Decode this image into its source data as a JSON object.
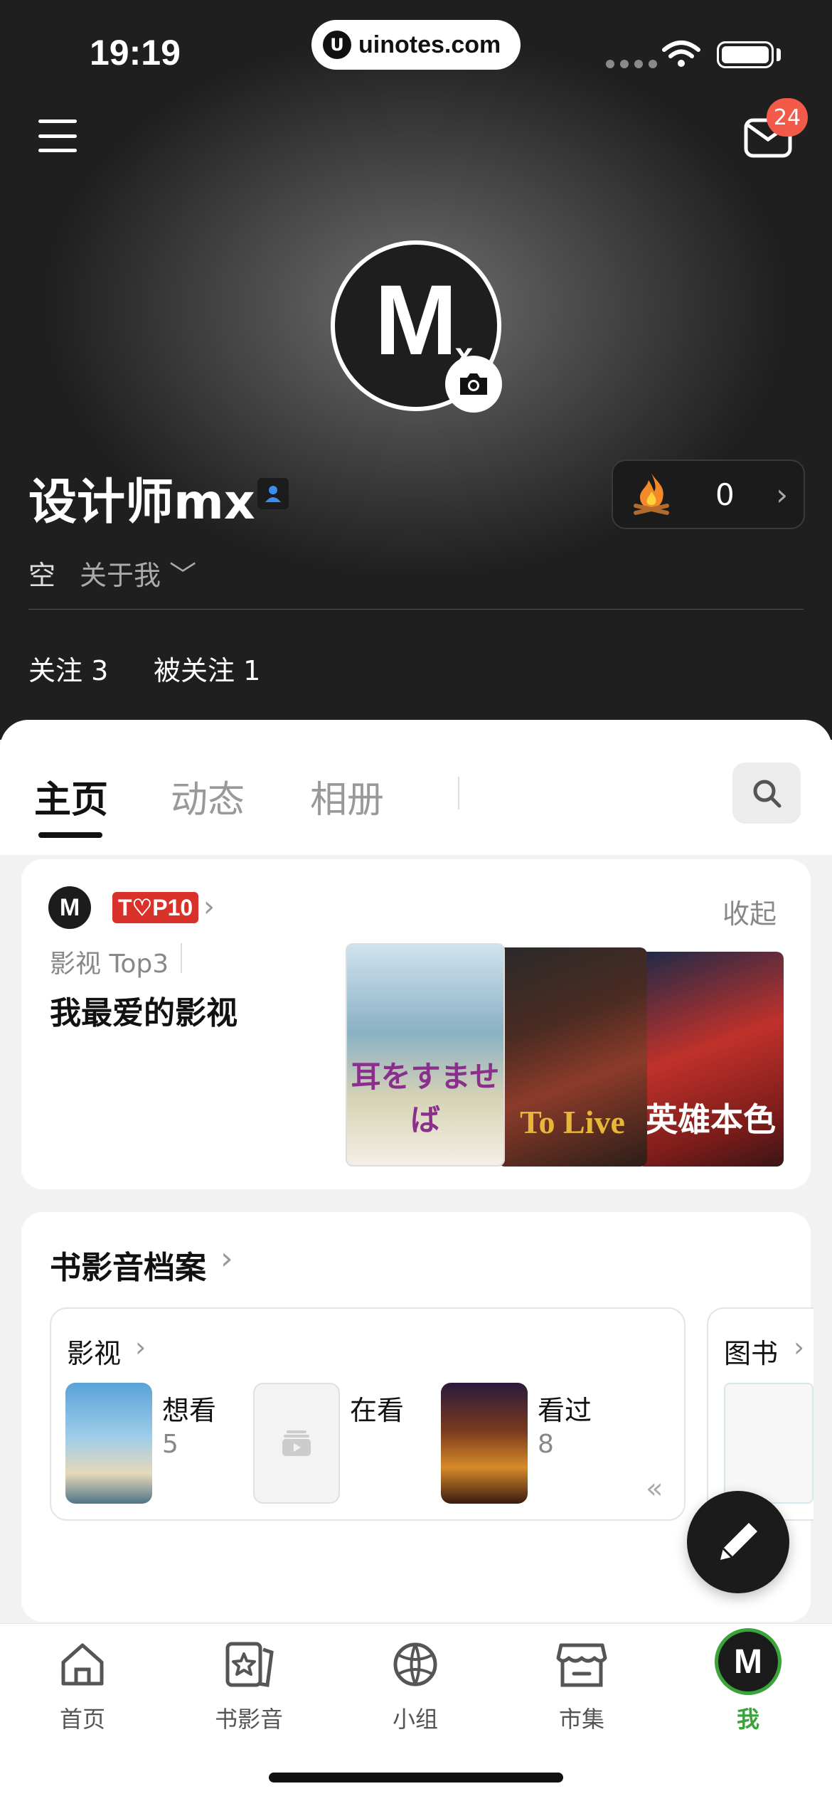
{
  "status_bar": {
    "time": "19:19",
    "url": "uinotes.com",
    "url_logo": "U"
  },
  "header": {
    "mail_badge": "24",
    "avatar_text": "M",
    "avatar_sub": "x",
    "username": "设计师mx",
    "fire_count": "0",
    "bio_empty": "空",
    "about_me": "关于我 ﹀",
    "following": "关注 3",
    "followers": "被关注 1"
  },
  "tabs": [
    "主页",
    "动态",
    "相册"
  ],
  "top_card": {
    "badge": "T♡P10",
    "collapse": "收起",
    "subtitle": "影视 Top3",
    "title": "我最爱的影视",
    "posters": [
      "耳をすませば",
      "To Live",
      "英雄本色"
    ]
  },
  "archive": {
    "title": "书影音档案",
    "film_label": "影视",
    "book_label": "图书",
    "stats": [
      {
        "label": "想看",
        "value": "5"
      },
      {
        "label": "在看",
        "value": ""
      },
      {
        "label": "看过",
        "value": "8"
      }
    ]
  },
  "tabbar": {
    "items": [
      "首页",
      "书影音",
      "小组",
      "市集",
      "我"
    ],
    "active_color": "#3aa33a"
  },
  "colors": {
    "badge_red": "#d9322a",
    "mail_badge": "#f25a4a",
    "active_green": "#3aa33a"
  }
}
